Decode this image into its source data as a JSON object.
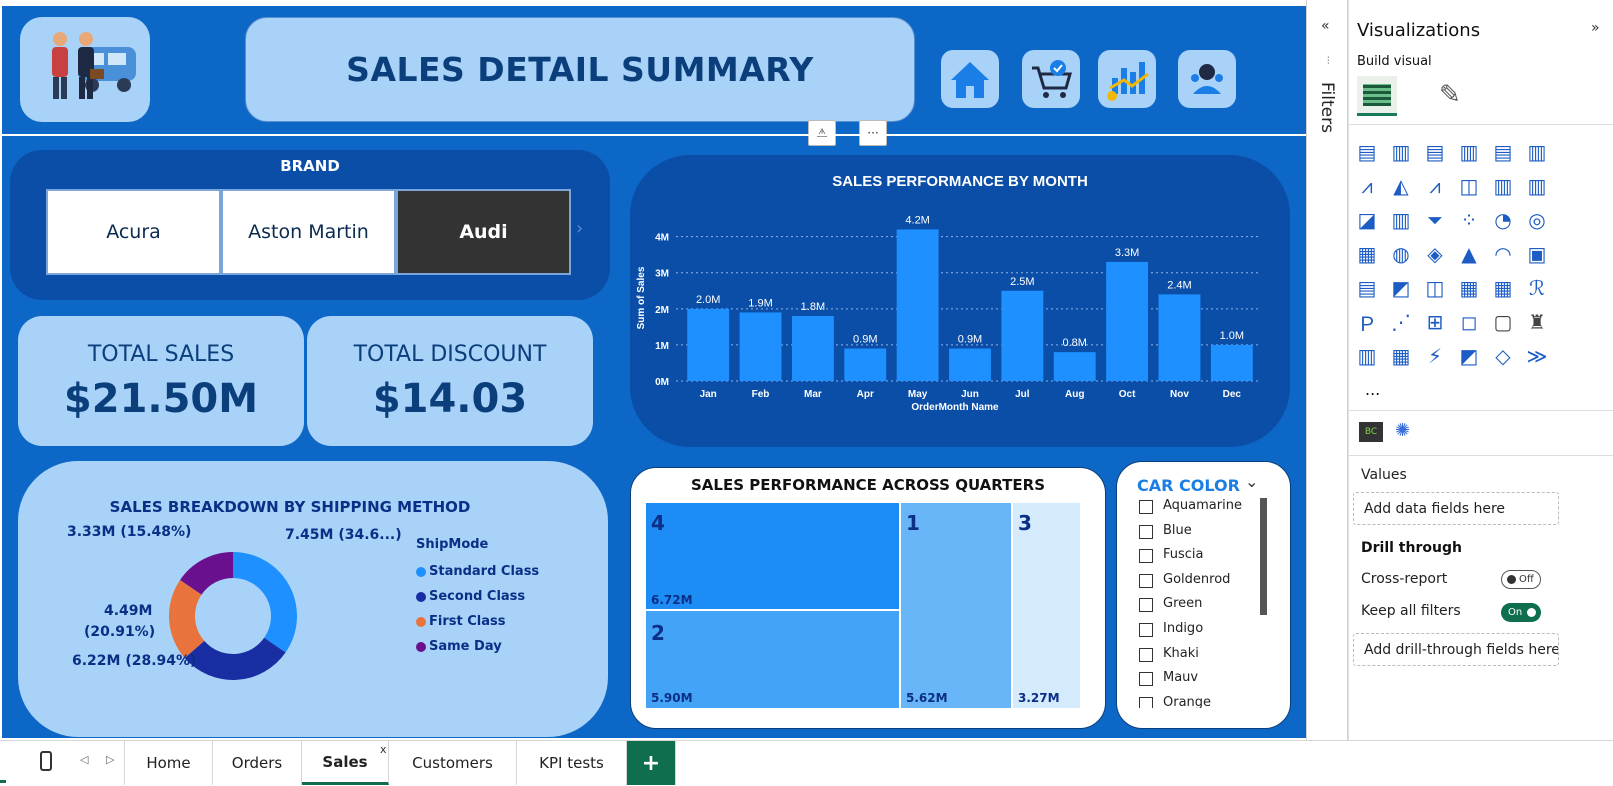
{
  "report": {
    "title": "SALES DETAIL SUMMARY",
    "brand": {
      "title": "BRAND",
      "buttons": [
        "Acura",
        "Aston Martin",
        "Audi"
      ],
      "selected": "Audi"
    },
    "kpis": [
      {
        "label": "TOTAL SALES",
        "value": "$21.50M"
      },
      {
        "label": "TOTAL DISCOUNT",
        "value": "$14.03"
      }
    ],
    "shipping": {
      "title": "SALES BREAKDOWN BY SHIPPING METHOD",
      "legend_title": "ShipMode",
      "labels": [
        "7.45M (34.6...)",
        "6.22M (28.94%)",
        "4.49M",
        "(20.91%)",
        "3.33M (15.48%)"
      ],
      "colors": {
        "standard": "#1e90ff",
        "second": "#1a2ea3",
        "first": "#e8733c",
        "same": "#6a0f8e"
      }
    },
    "quarters": {
      "title": "SALES PERFORMANCE ACROSS QUARTERS",
      "tiles": [
        {
          "q": "4",
          "value": "6.72M"
        },
        {
          "q": "2",
          "value": "5.90M"
        },
        {
          "q": "1",
          "value": "5.62M"
        },
        {
          "q": "3",
          "value": "3.27M"
        }
      ]
    },
    "car_color": {
      "title": "CAR COLOR",
      "items": [
        "Aquamarine",
        "Blue",
        "Fuscia",
        "Goldenrod",
        "Green",
        "Indigo",
        "Khaki",
        "Mauv",
        "Orange"
      ]
    }
  },
  "chart_data": [
    {
      "type": "bar",
      "title": "SALES PERFORMANCE BY MONTH",
      "xlabel": "OrderMonth Name",
      "ylabel": "Sum of Sales",
      "categories": [
        "Jan",
        "Feb",
        "Mar",
        "Apr",
        "May",
        "Jun",
        "Jul",
        "Aug",
        "Oct",
        "Nov",
        "Dec"
      ],
      "values": [
        2.0,
        1.9,
        1.8,
        0.9,
        4.2,
        0.9,
        2.5,
        0.8,
        3.3,
        2.4,
        1.0
      ],
      "value_labels": [
        "2.0M",
        "1.9M",
        "1.8M",
        "0.9M",
        "4.2M",
        "0.9M",
        "2.5M",
        "0.8M",
        "3.3M",
        "2.4M",
        "1.0M"
      ],
      "yticks": [
        "0M",
        "1M",
        "2M",
        "3M",
        "4M"
      ],
      "ylim": [
        0,
        4.6
      ],
      "grid": true,
      "color": "#1e90ff"
    },
    {
      "type": "pie",
      "title": "SALES BREAKDOWN BY SHIPPING METHOD",
      "categories": [
        "Standard Class",
        "Second Class",
        "First Class",
        "Same Day"
      ],
      "values": [
        7.45,
        6.22,
        4.49,
        3.33
      ],
      "percent": [
        34.67,
        28.94,
        20.91,
        15.48
      ]
    }
  ],
  "filters": {
    "label": "Filters"
  },
  "viz": {
    "title": "Visualizations",
    "build_visual": "Build visual",
    "more": "...",
    "values_label": "Values",
    "values_placeholder": "Add data fields here",
    "drill_through": "Drill through",
    "cross_report": "Cross-report",
    "cross_report_state": "Off",
    "keep_filters": "Keep all filters",
    "keep_filters_state": "On",
    "drill_placeholder": "Add drill-through fields here"
  },
  "tabs": {
    "items": [
      "Home",
      "Orders",
      "Sales",
      "Customers",
      "KPI tests"
    ],
    "active": "Sales",
    "close": "x",
    "add": "+"
  }
}
